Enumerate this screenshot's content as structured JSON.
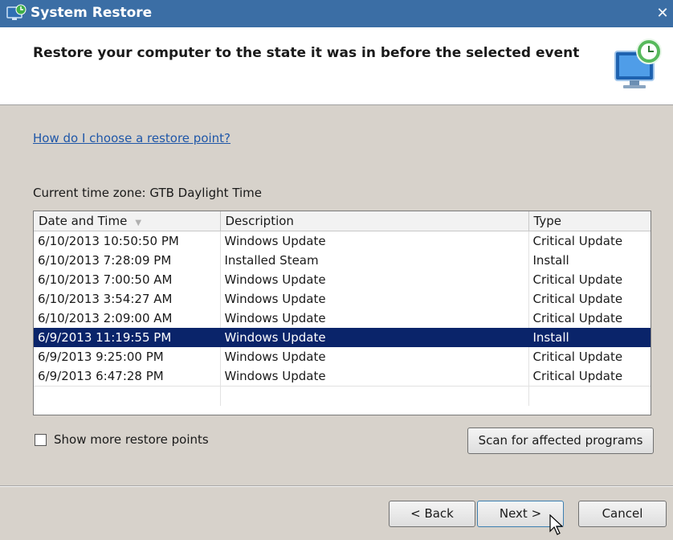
{
  "window": {
    "title": "System Restore"
  },
  "header": {
    "title": "Restore your computer to the state it was in before the selected event"
  },
  "help_link": "How do I choose a restore point?",
  "timezone_label": "Current time zone: GTB Daylight Time",
  "table": {
    "columns": [
      "Date and Time",
      "Description",
      "Type"
    ],
    "rows": [
      {
        "date": "6/10/2013 10:50:50 PM",
        "description": "Windows Update",
        "type": "Critical Update"
      },
      {
        "date": "6/10/2013 7:28:09 PM",
        "description": "Installed Steam",
        "type": "Install"
      },
      {
        "date": "6/10/2013 7:00:50 AM",
        "description": "Windows Update",
        "type": "Critical Update"
      },
      {
        "date": "6/10/2013 3:54:27 AM",
        "description": "Windows Update",
        "type": "Critical Update"
      },
      {
        "date": "6/10/2013 2:09:00 AM",
        "description": "Windows Update",
        "type": "Critical Update"
      },
      {
        "date": "6/9/2013 11:19:55 PM",
        "description": "Windows Update",
        "type": "Install"
      },
      {
        "date": "6/9/2013 9:25:00 PM",
        "description": "Windows Update",
        "type": "Critical Update"
      },
      {
        "date": "6/9/2013 6:47:28 PM",
        "description": "Windows Update",
        "type": "Critical Update"
      }
    ],
    "selected_row": 5
  },
  "show_more": {
    "label": "Show more restore points",
    "checked": false
  },
  "buttons": {
    "scan": "Scan for affected programs",
    "back": "< Back",
    "next": "Next >",
    "cancel": "Cancel"
  },
  "colors": {
    "title_bar": "#3b6ea5",
    "selection": "#0a246a",
    "link": "#1f57a8",
    "dialog_bg": "#d7d2cb"
  },
  "icons": {
    "app": "system-restore-icon",
    "header": "restore-computer-icon",
    "close": "close-icon",
    "cursor": "mouse-pointer-icon"
  }
}
